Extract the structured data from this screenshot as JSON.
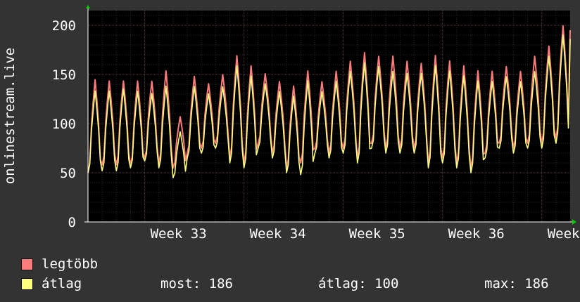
{
  "chart_data": {
    "type": "line",
    "ylabel": "onlinestream.live",
    "ylim": [
      0,
      215
    ],
    "y_ticks": [
      0,
      50,
      100,
      150,
      200
    ],
    "x_tick_labels": [
      "Week 33",
      "Week 34",
      "Week 35",
      "Week 36",
      "Week"
    ],
    "grid": true,
    "days": 34,
    "series": [
      {
        "name": "legtöbb",
        "color": "#ff7c7c",
        "daily_peak": [
          141,
          140,
          140,
          140,
          140,
          150,
          105,
          145,
          138,
          147,
          165,
          155,
          148,
          140,
          135,
          150,
          140,
          150,
          160,
          168,
          165,
          165,
          160,
          158,
          165,
          160,
          155,
          150,
          150,
          155,
          150,
          165,
          175,
          195
        ],
        "daily_low": [
          50,
          58,
          58,
          58,
          65,
          60,
          55,
          70,
          75,
          80,
          65,
          60,
          80,
          70,
          55,
          60,
          75,
          70,
          75,
          65,
          80,
          75,
          75,
          75,
          60,
          65,
          60,
          55,
          70,
          80,
          75,
          80,
          80,
          85
        ]
      },
      {
        "name": "átlag",
        "color": "#ffff80",
        "daily_peak": [
          130,
          130,
          132,
          130,
          128,
          135,
          90,
          135,
          128,
          135,
          155,
          145,
          138,
          130,
          125,
          140,
          130,
          140,
          150,
          158,
          155,
          150,
          148,
          148,
          155,
          150,
          145,
          140,
          140,
          145,
          140,
          150,
          165,
          186
        ],
        "daily_low": [
          50,
          52,
          52,
          55,
          62,
          55,
          45,
          65,
          70,
          75,
          60,
          55,
          75,
          65,
          50,
          48,
          70,
          65,
          70,
          60,
          75,
          70,
          70,
          70,
          55,
          60,
          55,
          50,
          65,
          75,
          70,
          75,
          75,
          80
        ]
      }
    ]
  },
  "legend": {
    "items": [
      {
        "label": "legtöbb",
        "color": "#ff7c7c"
      },
      {
        "label": "átlag",
        "color": "#ffff80"
      }
    ],
    "stats": {
      "now_label": "most:",
      "now_value": "186",
      "avg_label": "átlag:",
      "avg_value": "100",
      "max_label": "max:",
      "max_value": "186"
    }
  }
}
